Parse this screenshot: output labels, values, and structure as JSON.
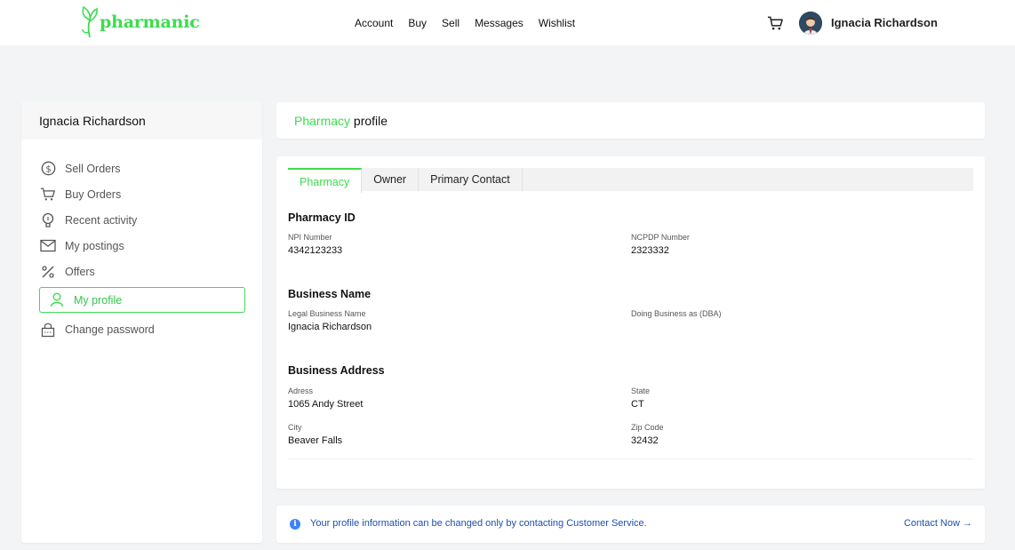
{
  "brand": {
    "name": "pharmanic",
    "accent_color": "#3ddc4e"
  },
  "nav": {
    "items": [
      {
        "label": "Account"
      },
      {
        "label": "Buy"
      },
      {
        "label": "Sell"
      },
      {
        "label": "Messages"
      },
      {
        "label": "Wishlist"
      }
    ]
  },
  "header": {
    "user_name": "Ignacia Richardson",
    "cart_icon": "cart-icon"
  },
  "sidebar": {
    "title": "Ignacia Richardson",
    "items": [
      {
        "label": "Sell Orders",
        "icon": "dollar-circle-icon"
      },
      {
        "label": "Buy Orders",
        "icon": "cart-icon"
      },
      {
        "label": "Recent activity",
        "icon": "lightbulb-icon"
      },
      {
        "label": "My postings",
        "icon": "envelope-icon"
      },
      {
        "label": "Offers",
        "icon": "percent-icon"
      },
      {
        "label": "My profile",
        "icon": "user-icon",
        "active": true
      },
      {
        "label": "Change password",
        "icon": "lock-icon"
      }
    ]
  },
  "page": {
    "title_accent": "Pharmacy",
    "title_rest": " profile"
  },
  "tabs": [
    {
      "label": "Pharmacy",
      "active": true
    },
    {
      "label": "Owner"
    },
    {
      "label": "Primary Contact"
    }
  ],
  "sections": {
    "pharmacy_id": {
      "title": "Pharmacy ID",
      "npi_label": "NPI Number",
      "npi_value": "4342123233",
      "ncpdp_label": "NCPDP Number",
      "ncpdp_value": "2323332"
    },
    "business_name": {
      "title": "Business Name",
      "legal_label": "Legal Business Name",
      "legal_value": "Ignacia Richardson",
      "dba_label": "Doing Business as (DBA)",
      "dba_value": ""
    },
    "business_address": {
      "title": "Business Address",
      "address_label": "Adress",
      "address_value": "1065 Andy Street",
      "state_label": "State",
      "state_value": "CT",
      "city_label": "City",
      "city_value": "Beaver Falls",
      "zip_label": "Zip Code",
      "zip_value": "32432"
    }
  },
  "info": {
    "message": "Your profile information can be changed only by contacting Customer Service.",
    "link_label": "Contact Now →"
  }
}
